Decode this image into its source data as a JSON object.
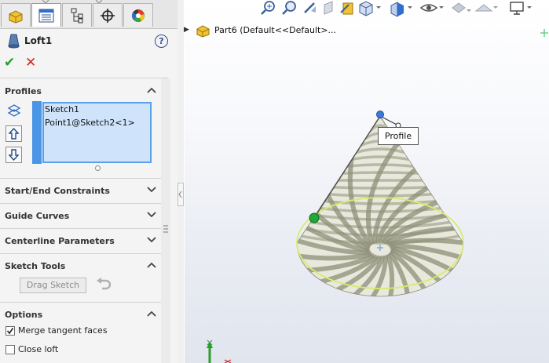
{
  "property_manager": {
    "title": "Loft1",
    "help_symbol": "?",
    "ok_symbol": "✔",
    "cancel_symbol": "✕",
    "tabs": [
      "feature-manager",
      "property-manager",
      "configuration-manager",
      "dimxpert-manager",
      "display-manager"
    ],
    "profiles": {
      "header": "Profiles",
      "items": [
        "Sketch1",
        "Point1@Sketch2<1>"
      ]
    },
    "sections": {
      "start_end": "Start/End Constraints",
      "guide_curves": "Guide Curves",
      "centerline": "Centerline Parameters",
      "sketch_tools": "Sketch Tools",
      "options": "Options"
    },
    "sketch_tools": {
      "drag_sketch": "Drag Sketch"
    },
    "options": {
      "merge_tangent": {
        "label": "Merge tangent faces",
        "checked": true
      },
      "close_loft": {
        "label": "Close loft",
        "checked": false
      }
    }
  },
  "graphics": {
    "tree_node": "Part6  (Default<<Default>...",
    "callout": "Profile",
    "cone_colors": {
      "light": "#e8e9dc",
      "dark": "#8e8f78",
      "edge": "#d6ec6a",
      "start_point": "#1ea83a",
      "apex_point": "#3b7bd8"
    }
  }
}
